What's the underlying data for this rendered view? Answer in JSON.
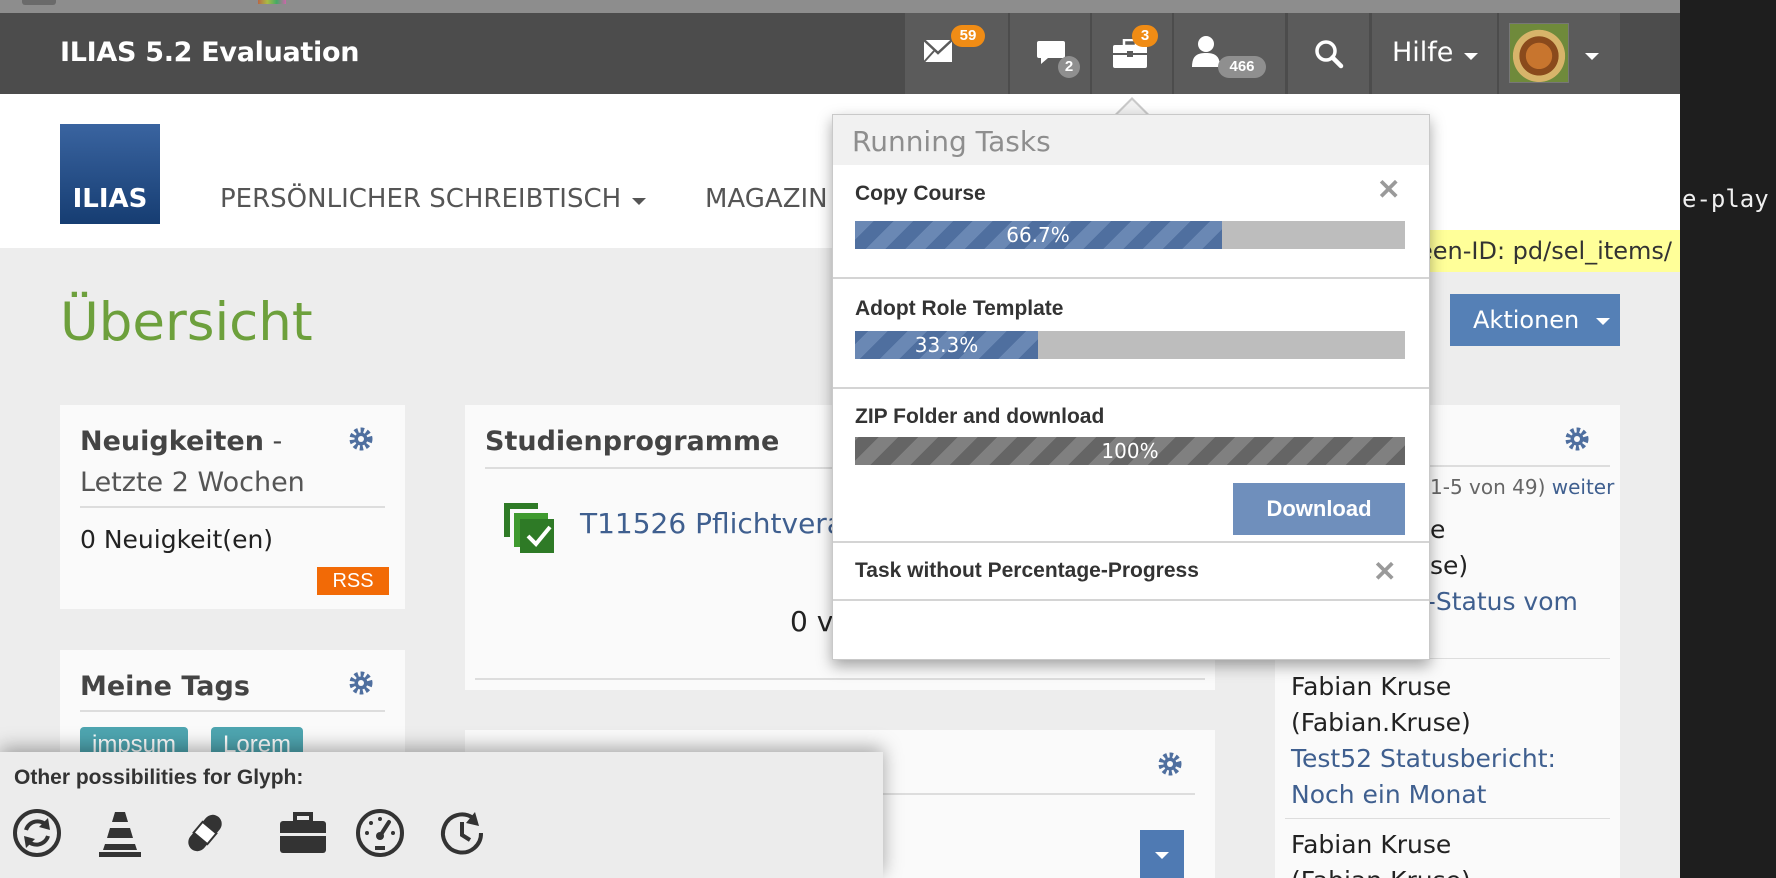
{
  "navbar": {
    "brand": "ILIAS 5.2 Evaluation",
    "mail_count": "59",
    "chat_count": "2",
    "tasks_count": "3",
    "contacts_count": "466",
    "help_label": "Hilfe"
  },
  "subheader": {
    "logo_text": "ILIAS",
    "nav_desktop": "PERSÖNLICHER SCHREIBTISCH",
    "nav_repo": "MAGAZIN"
  },
  "page": {
    "title": "Übersicht",
    "actions_label": "Aktionen",
    "screen_id": "een-ID: pd/sel_items/"
  },
  "news_panel": {
    "title_bold": "Neuigkeiten",
    "title_rest": " -",
    "subtitle": "Letzte 2 Wochen",
    "count": "0 Neuigkeit(en)",
    "rss": "RSS"
  },
  "tags_panel": {
    "title": "Meine Tags",
    "tags": [
      "impsum",
      "Lorem"
    ]
  },
  "study_panel": {
    "title": "Studienprogramme",
    "item": "T11526 Pflichtveran",
    "empty": "0 vo"
  },
  "right_panel": {
    "paging": "1-5 von 49)",
    "more_link": "weiter",
    "entries": [
      {
        "line1": "e",
        "line2": "se)",
        "link": "t-Status vom"
      },
      {
        "line1": "Fabian Kruse",
        "line2": "(Fabian.Kruse)",
        "link": "Test52 Statusbericht:",
        "link2": "Noch ein Monat"
      },
      {
        "line1": "Fabian Kruse",
        "line2": "(Fabian.Kruse)"
      }
    ]
  },
  "tasks_popover": {
    "header": "Running Tasks",
    "tasks": [
      {
        "title": "Copy Course",
        "progress": 66.7,
        "label": "66.7%"
      },
      {
        "title": "Adopt Role Template",
        "progress": 33.3,
        "label": "33.3%"
      },
      {
        "title": "ZIP Folder and download",
        "progress": 100,
        "label": "100%",
        "button": "Download"
      },
      {
        "title": "Task without Percentage-Progress"
      }
    ]
  },
  "glyph_panel": {
    "title": "Other possibilities for Glyph:",
    "glyphs": [
      "refresh-icon",
      "traffic-cone-icon",
      "bandage-icon",
      "briefcase-icon",
      "dashboard-icon",
      "history-icon"
    ]
  },
  "terminal": {
    "text": "e-play"
  },
  "colors": {
    "navbar": "#4c4c4c",
    "accent_green": "#6da03c",
    "accent_blue": "#5580b6",
    "badge_orange": "#f08c15",
    "rss_orange": "#f26a06"
  }
}
